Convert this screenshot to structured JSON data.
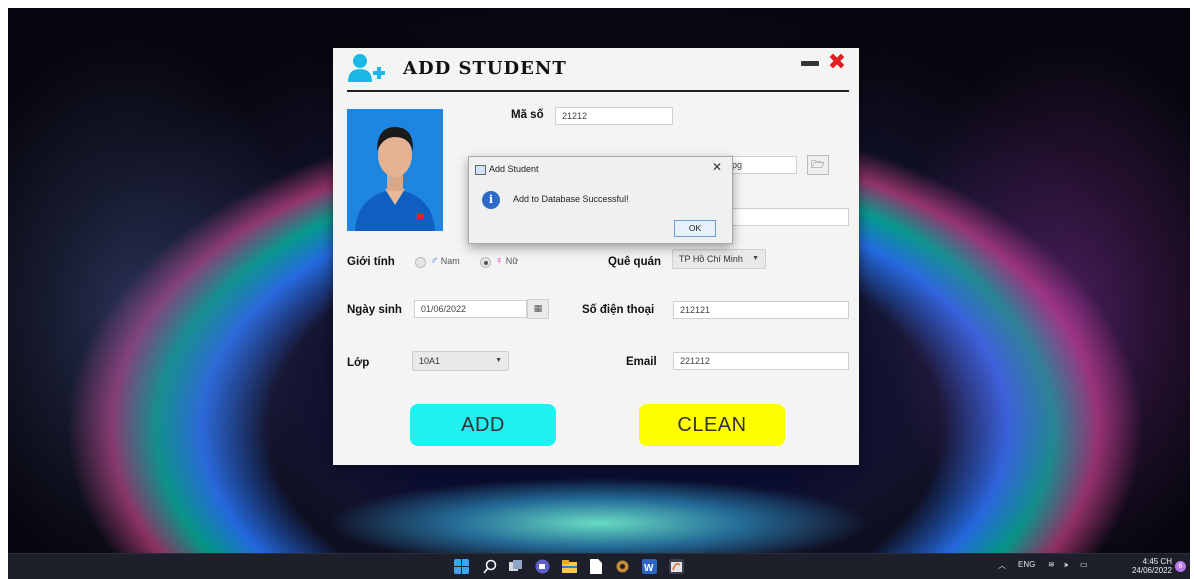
{
  "window": {
    "title": "ADD STUDENT"
  },
  "form": {
    "ma_so_label": "Mã số",
    "ma_so_value": "21212",
    "image_path_value": "jpg",
    "gioi_tinh_label": "Giới tính",
    "gender_male": "Nam",
    "gender_female": "Nữ",
    "que_quan_label": "Quê quán",
    "que_quan_value": "TP Hồ Chí Minh",
    "ngay_sinh_label": "Ngày sinh",
    "ngay_sinh_value": "01/06/2022",
    "so_dien_thoai_label": "Số điện thoại",
    "so_dien_thoai_value": "212121",
    "lop_label": "Lớp",
    "lop_value": "10A1",
    "email_label": "Email",
    "email_value": "221212"
  },
  "buttons": {
    "add": "ADD",
    "clean": "CLEAN"
  },
  "dialog": {
    "title": "Add Student",
    "message": "Add to Database Successful!",
    "ok": "OK"
  },
  "taskbar": {
    "language": "ENG",
    "time": "4:45 CH",
    "date": "24/06/2022",
    "notifications": "6"
  },
  "colors": {
    "add_button": "#1ff0f0",
    "clean_button": "#ffff00",
    "close_icon": "#e41e1e",
    "info_icon": "#2f6bc5"
  }
}
